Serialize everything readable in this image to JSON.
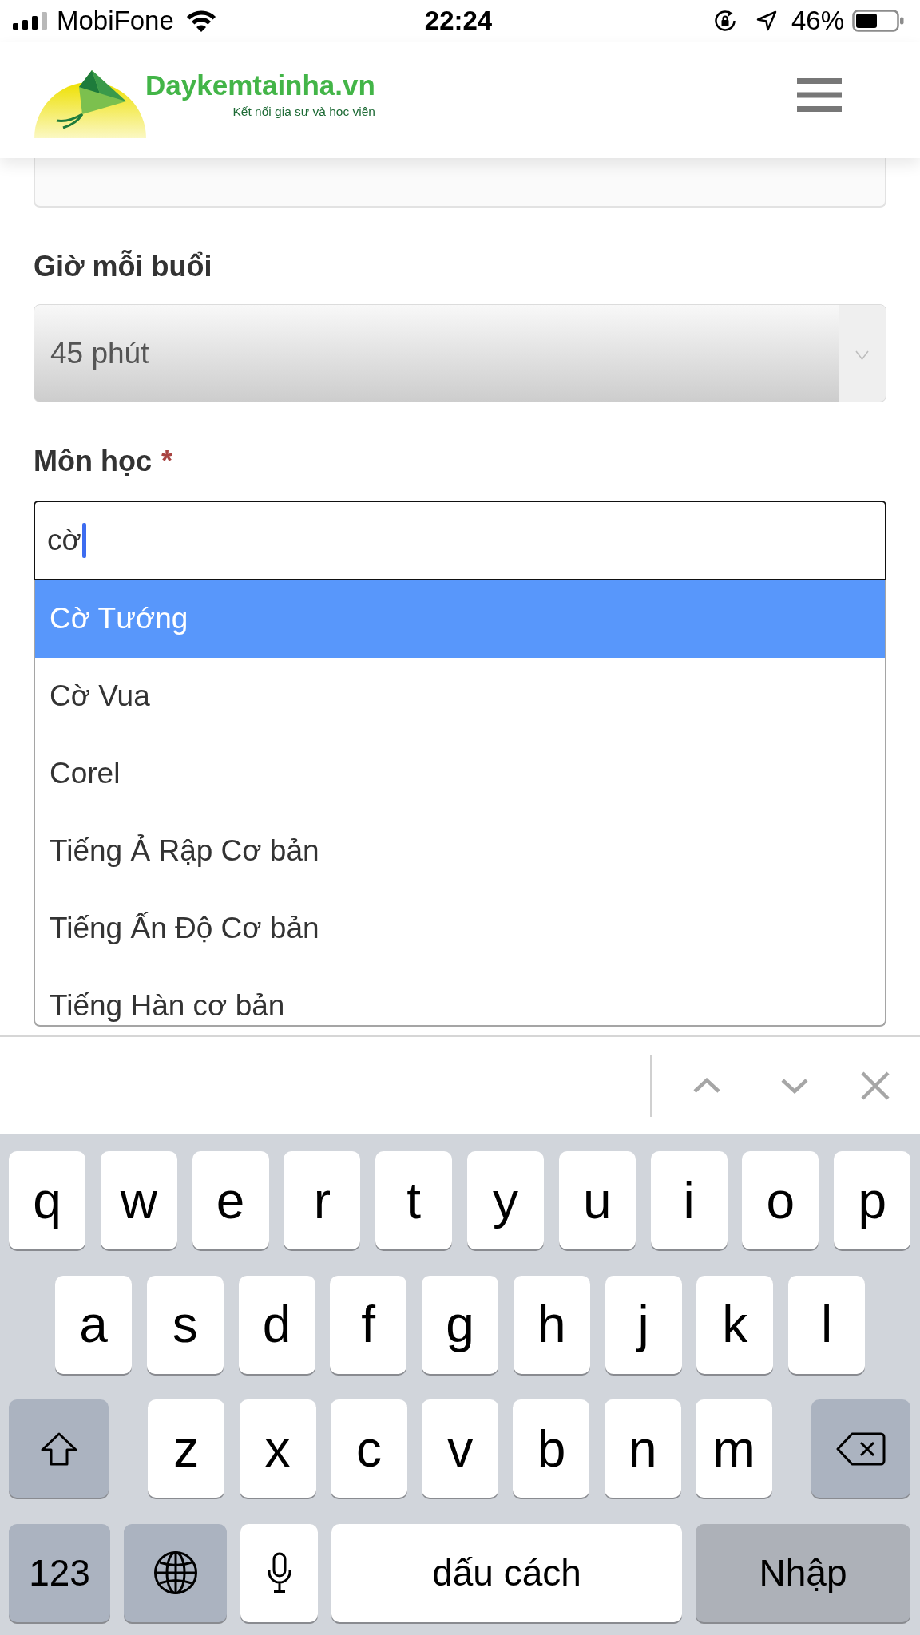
{
  "status_bar": {
    "carrier": "MobiFone",
    "time": "22:24",
    "battery": "46%"
  },
  "header": {
    "title": "Daykemtainha.vn",
    "tagline": "Kết nối gia sư và học viên"
  },
  "form": {
    "fields": [
      {
        "kind": "input"
      },
      {
        "kind": "select",
        "label": "Giờ mỗi buổi",
        "value": "45 phút"
      },
      {
        "kind": "autocomplete",
        "label": "Môn học",
        "required_mark": "*",
        "value": "cờ",
        "focused": true,
        "suggestions": [
          {
            "label": "Cờ Tướng",
            "selected": true
          },
          {
            "label": "Cờ Vua",
            "selected": false
          },
          {
            "label": "Corel",
            "selected": false
          },
          {
            "label": "Tiếng Ả Rập Cơ bản",
            "selected": false
          },
          {
            "label": "Tiếng Ấn Độ Cơ bản",
            "selected": false
          },
          {
            "label": "Tiếng Hàn cơ bản",
            "selected": false
          }
        ]
      }
    ]
  },
  "accessory_bar": {
    "buttons": [
      {
        "kind": "previous"
      },
      {
        "kind": "next"
      },
      {
        "kind": "done"
      }
    ]
  },
  "keyboard": {
    "rows": [
      {
        "keys": [
          {
            "kind": "letter",
            "label": "q"
          },
          {
            "kind": "letter",
            "label": "w"
          },
          {
            "kind": "letter",
            "label": "e"
          },
          {
            "kind": "letter",
            "label": "r"
          },
          {
            "kind": "letter",
            "label": "t"
          },
          {
            "kind": "letter",
            "label": "y"
          },
          {
            "kind": "letter",
            "label": "u"
          },
          {
            "kind": "letter",
            "label": "i"
          },
          {
            "kind": "letter",
            "label": "o"
          },
          {
            "kind": "letter",
            "label": "p"
          }
        ]
      },
      {
        "keys": [
          {
            "kind": "letter",
            "label": "a"
          },
          {
            "kind": "letter",
            "label": "s"
          },
          {
            "kind": "letter",
            "label": "d"
          },
          {
            "kind": "letter",
            "label": "f"
          },
          {
            "kind": "letter",
            "label": "g"
          },
          {
            "kind": "letter",
            "label": "h"
          },
          {
            "kind": "letter",
            "label": "j"
          },
          {
            "kind": "letter",
            "label": "k"
          },
          {
            "kind": "letter",
            "label": "l"
          }
        ]
      },
      {
        "keys": [
          {
            "kind": "shift",
            "on": false
          },
          {
            "kind": "letter",
            "label": "z"
          },
          {
            "kind": "letter",
            "label": "x"
          },
          {
            "kind": "letter",
            "label": "c"
          },
          {
            "kind": "letter",
            "label": "v"
          },
          {
            "kind": "letter",
            "label": "b"
          },
          {
            "kind": "letter",
            "label": "n"
          },
          {
            "kind": "letter",
            "label": "m"
          },
          {
            "kind": "delete"
          }
        ]
      },
      {
        "keys": [
          {
            "kind": "numbers",
            "label": "123"
          },
          {
            "kind": "globe"
          },
          {
            "kind": "mic"
          },
          {
            "kind": "space",
            "label": "dấu cách"
          },
          {
            "kind": "return",
            "label": "Nhập"
          }
        ]
      }
    ]
  }
}
